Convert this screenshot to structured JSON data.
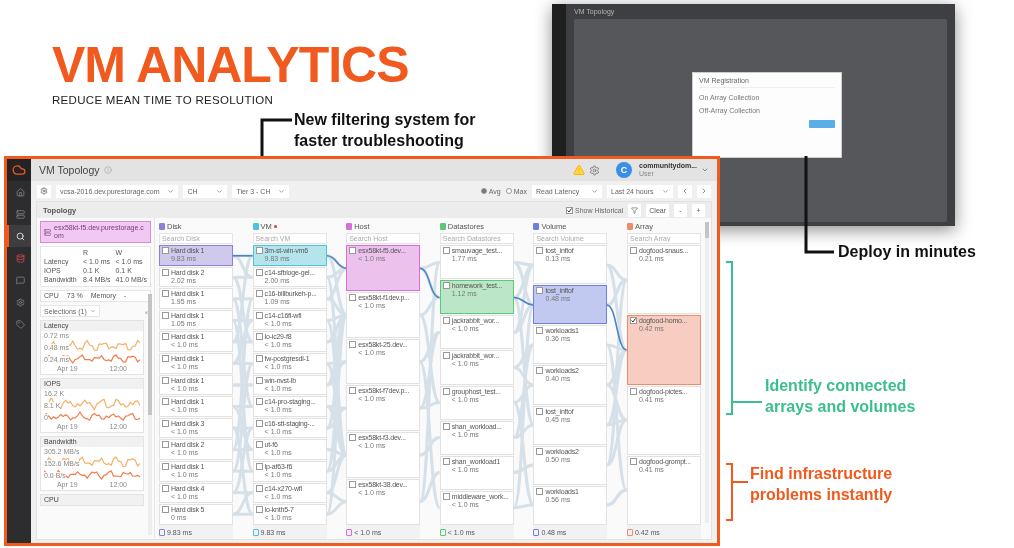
{
  "headline": {
    "title": "VM ANALYTICS",
    "subtitle": "REDUCE MEAN TIME TO RESOLUTION"
  },
  "callouts": [
    {
      "kind": "filter",
      "color": "#111111",
      "lines": [
        "New filtering system for",
        "faster troubleshooting"
      ]
    },
    {
      "kind": "deploy",
      "color": "#111111",
      "lines": [
        "Deploy in minutes"
      ]
    },
    {
      "kind": "identify",
      "color": "#3bbf8c",
      "lines": [
        "Identify connected",
        "arrays and volumes"
      ]
    },
    {
      "kind": "find",
      "color": "#f05a1e",
      "lines": [
        "Find infrastructure",
        "problems instantly"
      ]
    }
  ],
  "background_screenshot": {
    "title": "VM Topology",
    "dialog": {
      "title": "VM Registration",
      "sections": [
        "On Array Collection",
        "Off-Array Collection"
      ]
    }
  },
  "app": {
    "title": "VM Topology",
    "user": {
      "initial": "C",
      "name": "communitydom...",
      "role": "User"
    },
    "sidebar": [
      {
        "selected": false
      },
      {
        "selected": false
      },
      {
        "selected": true
      },
      {
        "selected": false
      },
      {
        "selected": false
      },
      {
        "selected": false
      },
      {
        "selected": false
      }
    ],
    "toolbar": {
      "selects": [
        "vcsa-2016.dev.purestorage.com",
        "CH",
        "Tier 3 - CH"
      ],
      "modes": [
        {
          "label": "Avg",
          "selected": true
        },
        {
          "label": "Max",
          "selected": false
        }
      ],
      "metric": "Read Latency",
      "range": "Last 24 hours"
    },
    "topology": {
      "title": "Topology",
      "show_historical": {
        "label": "Show Historical",
        "checked": true
      },
      "clear": "Clear",
      "zoom_out": "-",
      "zoom_in": "+"
    },
    "details": {
      "host": "esx58kt-f5.dev.purestorage.com",
      "headers": [
        "R",
        "W"
      ],
      "rows": [
        {
          "label": "Latency",
          "values": [
            "< 1.0 ms",
            "< 1.0 ms"
          ]
        },
        {
          "label": "IOPS",
          "values": [
            "0.1 K",
            "0.1 K"
          ]
        },
        {
          "label": "Bandwidth",
          "values": [
            "8.4 MB/s",
            "41.0 MB/s"
          ]
        }
      ],
      "cpu_label": "CPU",
      "cpu": "73 %",
      "memory_label": "Memory",
      "memory": "-",
      "selections": "Selections (1)"
    },
    "charts": [
      {
        "title": "Latency",
        "yticks": [
          "0.72 ms",
          "0.48 ms",
          "0.24 ms"
        ],
        "xticks": [
          "Apr 19",
          "12:00"
        ]
      },
      {
        "title": "IOPS",
        "yticks": [
          "16.2 K",
          "8.1 K",
          "0"
        ],
        "xticks": [
          "Apr 19",
          "12:00"
        ]
      },
      {
        "title": "Bandwidth",
        "yticks": [
          "305.2 MB/s",
          "152.6 MB/s",
          "0.0 B/s"
        ],
        "xticks": [
          "Apr 19",
          "12:00"
        ]
      },
      {
        "title": "CPU"
      }
    ],
    "columns": [
      {
        "title": "Disk",
        "color": "#8e7fd8",
        "flagged": false,
        "placeholder": "Search Disk",
        "total": "9.83 ms",
        "nodes": [
          {
            "name": "Hard disk 1",
            "value": "9.83 ms",
            "selected": true,
            "checked": false
          },
          {
            "name": "Hard disk 2",
            "value": "2.02 ms",
            "selected": false,
            "checked": false
          },
          {
            "name": "Hard disk 1",
            "value": "1.95 ms",
            "selected": false,
            "checked": false
          },
          {
            "name": "Hard disk 1",
            "value": "1.05 ms",
            "selected": false,
            "checked": false
          },
          {
            "name": "Hard disk 1",
            "value": "< 1.0 ms",
            "selected": false,
            "checked": false
          },
          {
            "name": "Hard disk 1",
            "value": "< 1.0 ms",
            "selected": false,
            "checked": false
          },
          {
            "name": "Hard disk 1",
            "value": "< 1.0 ms",
            "selected": false,
            "checked": false
          },
          {
            "name": "Hard disk 1",
            "value": "< 1.0 ms",
            "selected": false,
            "checked": false
          },
          {
            "name": "Hard disk 3",
            "value": "< 1.0 ms",
            "selected": false,
            "checked": false
          },
          {
            "name": "Hard disk 2",
            "value": "< 1.0 ms",
            "selected": false,
            "checked": false
          },
          {
            "name": "Hard disk 1",
            "value": "< 1.0 ms",
            "selected": false,
            "checked": false
          },
          {
            "name": "Hard disk 4",
            "value": "< 1.0 ms",
            "selected": false,
            "checked": false
          },
          {
            "name": "Hard disk 5",
            "value": "0 ms",
            "selected": false,
            "checked": false
          }
        ]
      },
      {
        "title": "VM",
        "color": "#4fc3d9",
        "flagged": true,
        "placeholder": "Search VM",
        "total": "9.83 ms",
        "nodes": [
          {
            "name": "3m-st-win-vm6",
            "value": "9.83 ms",
            "selected": true,
            "checked": false
          },
          {
            "name": "c14-sfbloge-gel...",
            "value": "2.00 ms",
            "selected": false,
            "checked": false
          },
          {
            "name": "c16-billburkeh-p...",
            "value": "1.09 ms",
            "selected": false,
            "checked": false
          },
          {
            "name": "c14-c16fl-wfl",
            "value": "< 1.0 ms",
            "selected": false,
            "checked": false
          },
          {
            "name": "lo-ic29-f8",
            "value": "< 1.0 ms",
            "selected": false,
            "checked": false
          },
          {
            "name": "fw-postgresdl-1",
            "value": "< 1.0 ms",
            "selected": false,
            "checked": false
          },
          {
            "name": "win-nvst-lb",
            "value": "< 1.0 ms",
            "selected": false,
            "checked": false
          },
          {
            "name": "c14-pro-staging...",
            "value": "< 1.0 ms",
            "selected": false,
            "checked": false
          },
          {
            "name": "c16-stt-staging-...",
            "value": "< 1.0 ms",
            "selected": false,
            "checked": false
          },
          {
            "name": "ut-f6",
            "value": "< 1.0 ms",
            "selected": false,
            "checked": false
          },
          {
            "name": "lp-af63-f6",
            "value": "< 1.0 ms",
            "selected": false,
            "checked": false
          },
          {
            "name": "c14-x270-wfl",
            "value": "< 1.0 ms",
            "selected": false,
            "checked": false
          },
          {
            "name": "lo-knth5-7",
            "value": "< 1.0 ms",
            "selected": false,
            "checked": false
          }
        ]
      },
      {
        "title": "Host",
        "color": "#d86fd8",
        "flagged": false,
        "placeholder": "Search Host",
        "total": "< 1.0 ms",
        "nodes": [
          {
            "name": "esx58kt-f5.dev...",
            "value": "< 1.0 ms",
            "selected": true,
            "checked": false
          },
          {
            "name": "esx58kt-f1dev.p...",
            "value": "< 1.0 ms",
            "selected": false,
            "checked": false
          },
          {
            "name": "esx58kt-25.dev...",
            "value": "< 1.0 ms",
            "selected": false,
            "checked": false
          },
          {
            "name": "esx58kt-f7dev.p...",
            "value": "< 1.0 ms",
            "selected": false,
            "checked": false
          },
          {
            "name": "esx58kt-f3.dev...",
            "value": "< 1.0 ms",
            "selected": false,
            "checked": false
          },
          {
            "name": "esx58kt-38.dev...",
            "value": "< 1.0 ms",
            "selected": false,
            "checked": false
          }
        ]
      },
      {
        "title": "Datastores",
        "color": "#5cc97a",
        "flagged": false,
        "placeholder": "Search Datastores",
        "total": "< 1.0 ms",
        "nodes": [
          {
            "name": "smauvage_test...",
            "value": "1.77 ms",
            "selected": false,
            "checked": false
          },
          {
            "name": "homework_test...",
            "value": "1.12 ms",
            "selected": true,
            "checked": false
          },
          {
            "name": "jackrabbit_wor...",
            "value": "< 1.0 ms",
            "selected": false,
            "checked": false
          },
          {
            "name": "jackrabbit_wor...",
            "value": "< 1.0 ms",
            "selected": false,
            "checked": false
          },
          {
            "name": "grouphost_test...",
            "value": "< 1.0 ms",
            "selected": false,
            "checked": false
          },
          {
            "name": "shan_workload...",
            "value": "< 1.0 ms",
            "selected": false,
            "checked": false
          },
          {
            "name": "shan_workload1",
            "value": "< 1.0 ms",
            "selected": false,
            "checked": false
          },
          {
            "name": "middleware_work...",
            "value": "< 1.0 ms",
            "selected": false,
            "checked": false
          }
        ]
      },
      {
        "title": "Volume",
        "color": "#6f7fe0",
        "flagged": false,
        "placeholder": "Search Volume",
        "total": "0.48 ms",
        "nodes": [
          {
            "name": "tost_inftof",
            "value": "0.13 ms",
            "selected": false,
            "checked": false
          },
          {
            "name": "tost_inftof",
            "value": "0.48 ms",
            "selected": true,
            "checked": false
          },
          {
            "name": "workloads1",
            "value": "0.36 ms",
            "selected": false,
            "checked": false
          },
          {
            "name": "workloads2",
            "value": "0.40 ms",
            "selected": false,
            "checked": false
          },
          {
            "name": "tost_inftof",
            "value": "0.45 ms",
            "selected": false,
            "checked": false
          },
          {
            "name": "workloads2",
            "value": "0.50 ms",
            "selected": false,
            "checked": false
          },
          {
            "name": "workloads1",
            "value": "0.56 ms",
            "selected": false,
            "checked": false
          }
        ]
      },
      {
        "title": "Array",
        "color": "#f08a6a",
        "flagged": false,
        "placeholder": "Search Array",
        "total": "0.42 ms",
        "nodes": [
          {
            "name": "dogfood-snaus...",
            "value": "0.21 ms",
            "selected": false,
            "checked": false
          },
          {
            "name": "dogfood-homo...",
            "value": "0.42 ms",
            "selected": true,
            "checked": true
          },
          {
            "name": "dogfood-pictes...",
            "value": "0.41 ms",
            "selected": false,
            "checked": false
          },
          {
            "name": "dogfood-grompt...",
            "value": "0.41 ms",
            "selected": false,
            "checked": false
          }
        ]
      }
    ]
  }
}
